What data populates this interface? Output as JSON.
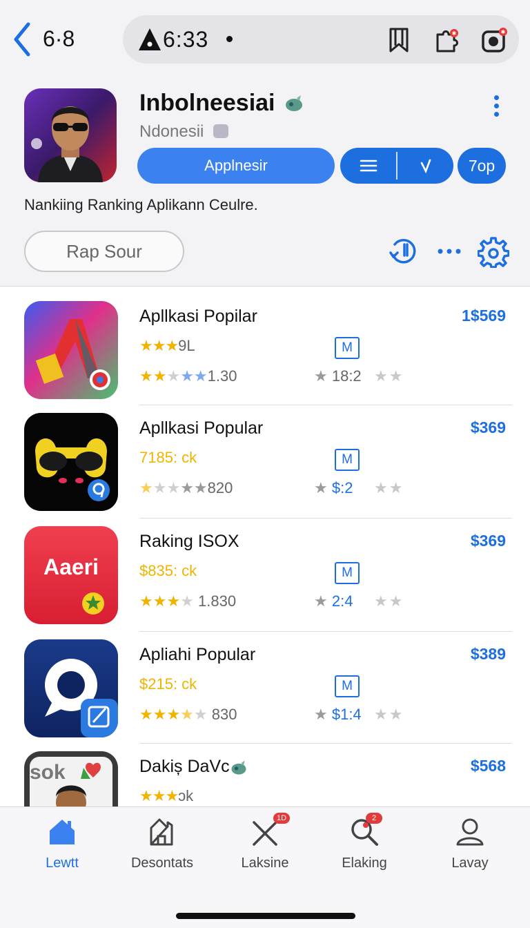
{
  "status": {
    "back_label": "6·8",
    "time": "6:33",
    "icons": [
      "warning-icon",
      "bookmark-icon",
      "puzzle-icon",
      "camera-icon"
    ]
  },
  "header": {
    "title": "Inbolneesiai",
    "subtitle": "Ndonesii",
    "primary_button": "Applnesir",
    "top_button": "7op",
    "description": "Nankiing Ranking Aplikann Ceulre.",
    "rap_button": "Rap Sour"
  },
  "apps": [
    {
      "name": "Apllkasi Popilar",
      "price": "1$569",
      "meta_value": "9L",
      "badge": "M",
      "rating": "1.30",
      "secondary": "18:2"
    },
    {
      "name": "Apllkasi Popular",
      "price": "$369",
      "meta_value": "7185: ck",
      "badge": "M",
      "rating": "820",
      "secondary": "$:2"
    },
    {
      "name": "Raking ISOX",
      "price": "$369",
      "meta_value": "$835: ck",
      "badge": "M",
      "rating": "1.830",
      "secondary": "2:4"
    },
    {
      "name": "Apliahi Popular",
      "price": "$389",
      "meta_value": "$215: ck",
      "badge": "M",
      "rating": "830",
      "secondary": "$1:4"
    },
    {
      "name": "Dakiș DaVc",
      "price": "$568",
      "meta_value": "ɔk"
    }
  ],
  "nav": {
    "items": [
      {
        "label": "Lewtt",
        "icon": "home-icon"
      },
      {
        "label": "Desontats",
        "icon": "house-outline-icon"
      },
      {
        "label": "Laksine",
        "icon": "close-icon",
        "badge": "1D"
      },
      {
        "label": "Elaking",
        "icon": "search-icon",
        "badge": "2"
      },
      {
        "label": "Lavay",
        "icon": "profile-icon"
      }
    ]
  },
  "colors": {
    "accent": "#1d6fe0",
    "accent_light": "#3b82f0",
    "star": "#f0b400",
    "badge_red": "#e23b3b"
  }
}
